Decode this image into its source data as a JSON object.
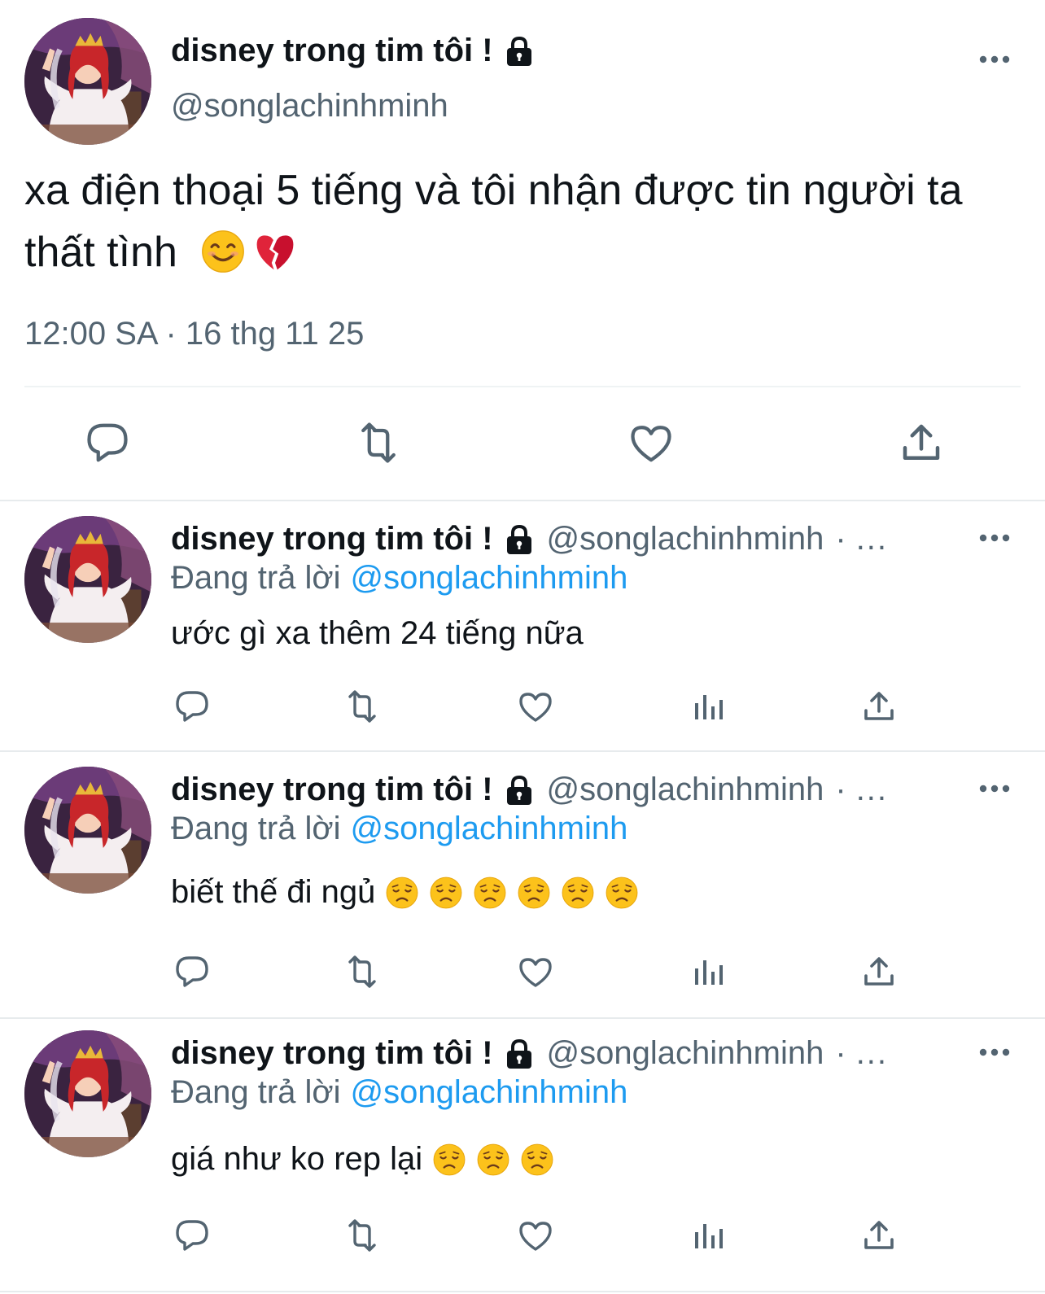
{
  "main_tweet": {
    "author_name": "disney trong tim tôi !",
    "author_handle": "@songlachinhminh",
    "text": "xa điện thoại 5 tiếng và tôi nhận được tin người ta thất tình",
    "emojis": [
      "smiling-face-emoji",
      "broken-heart-emoji"
    ],
    "timestamp": "12:00 SA · 16 thg 11 25",
    "actions": [
      "reply-icon",
      "retweet-icon",
      "like-icon",
      "share-icon"
    ]
  },
  "replies": [
    {
      "author_name": "disney trong tim tôi !",
      "author_handle": "@songlachinhminh",
      "separator": "·",
      "truncation": "...",
      "replying_label": "Đang trả lời",
      "replying_to": "@songlachinhminh",
      "text": "ước gì xa thêm 24 tiếng nữa",
      "emojis": [],
      "actions": [
        "reply-icon",
        "retweet-icon",
        "like-icon",
        "views-icon",
        "share-icon"
      ]
    },
    {
      "author_name": "disney trong tim tôi !",
      "author_handle": "@songlachinhminh",
      "separator": "·",
      "truncation": "...",
      "replying_label": "Đang trả lời",
      "replying_to": "@songlachinhminh",
      "text": "biết thế đi ngủ",
      "emojis": [
        "disappointed-face-emoji",
        "disappointed-face-emoji",
        "disappointed-face-emoji",
        "disappointed-face-emoji",
        "disappointed-face-emoji",
        "disappointed-face-emoji"
      ],
      "actions": [
        "reply-icon",
        "retweet-icon",
        "like-icon",
        "views-icon",
        "share-icon"
      ]
    },
    {
      "author_name": "disney trong tim tôi !",
      "author_handle": "@songlachinhminh",
      "separator": "·",
      "truncation": "...",
      "replying_label": "Đang trả lời",
      "replying_to": "@songlachinhminh",
      "text": "giá như ko rep lại",
      "emojis": [
        "disappointed-face-emoji",
        "disappointed-face-emoji",
        "disappointed-face-emoji"
      ],
      "actions": [
        "reply-icon",
        "retweet-icon",
        "like-icon",
        "views-icon",
        "share-icon"
      ]
    }
  ],
  "colors": {
    "text_primary": "#0f1419",
    "text_secondary": "#536471",
    "link": "#1d9bf0",
    "divider": "#eff3f4"
  }
}
